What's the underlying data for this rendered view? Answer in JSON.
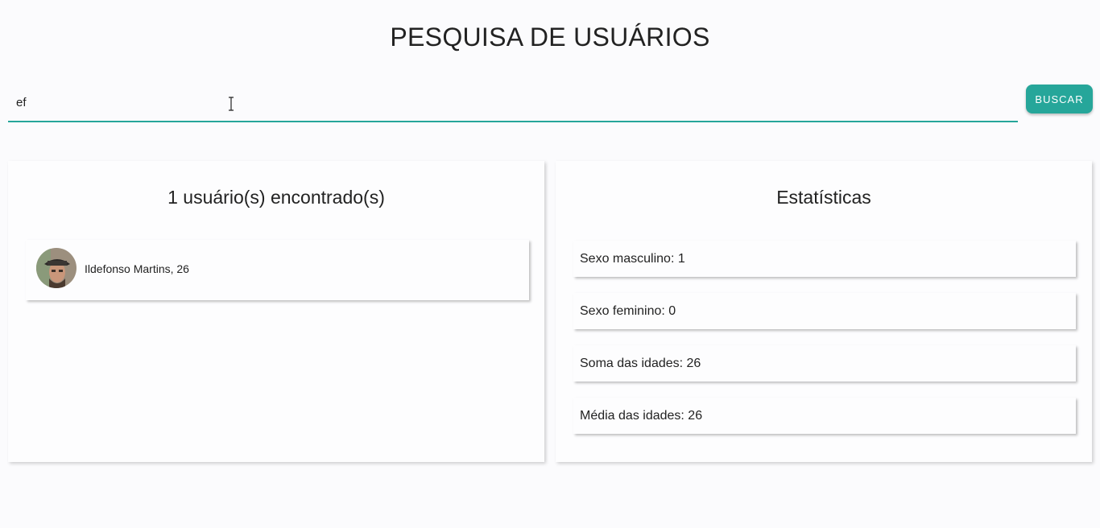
{
  "header": {
    "title": "PESQUISA DE USUÁRIOS"
  },
  "search": {
    "value": "ef",
    "button_label": "BUSCAR",
    "accent_color": "#26a69a"
  },
  "results": {
    "title": "1 usuário(s) encontrado(s)",
    "users": [
      {
        "display": "Ildefonso Martins, 26",
        "avatar": "user-avatar-photo"
      }
    ]
  },
  "stats": {
    "title": "Estatísticas",
    "items": [
      {
        "label": "Sexo masculino: 1"
      },
      {
        "label": "Sexo feminino: 0"
      },
      {
        "label": "Soma das idades: 26"
      },
      {
        "label": "Média das idades: 26"
      }
    ]
  }
}
